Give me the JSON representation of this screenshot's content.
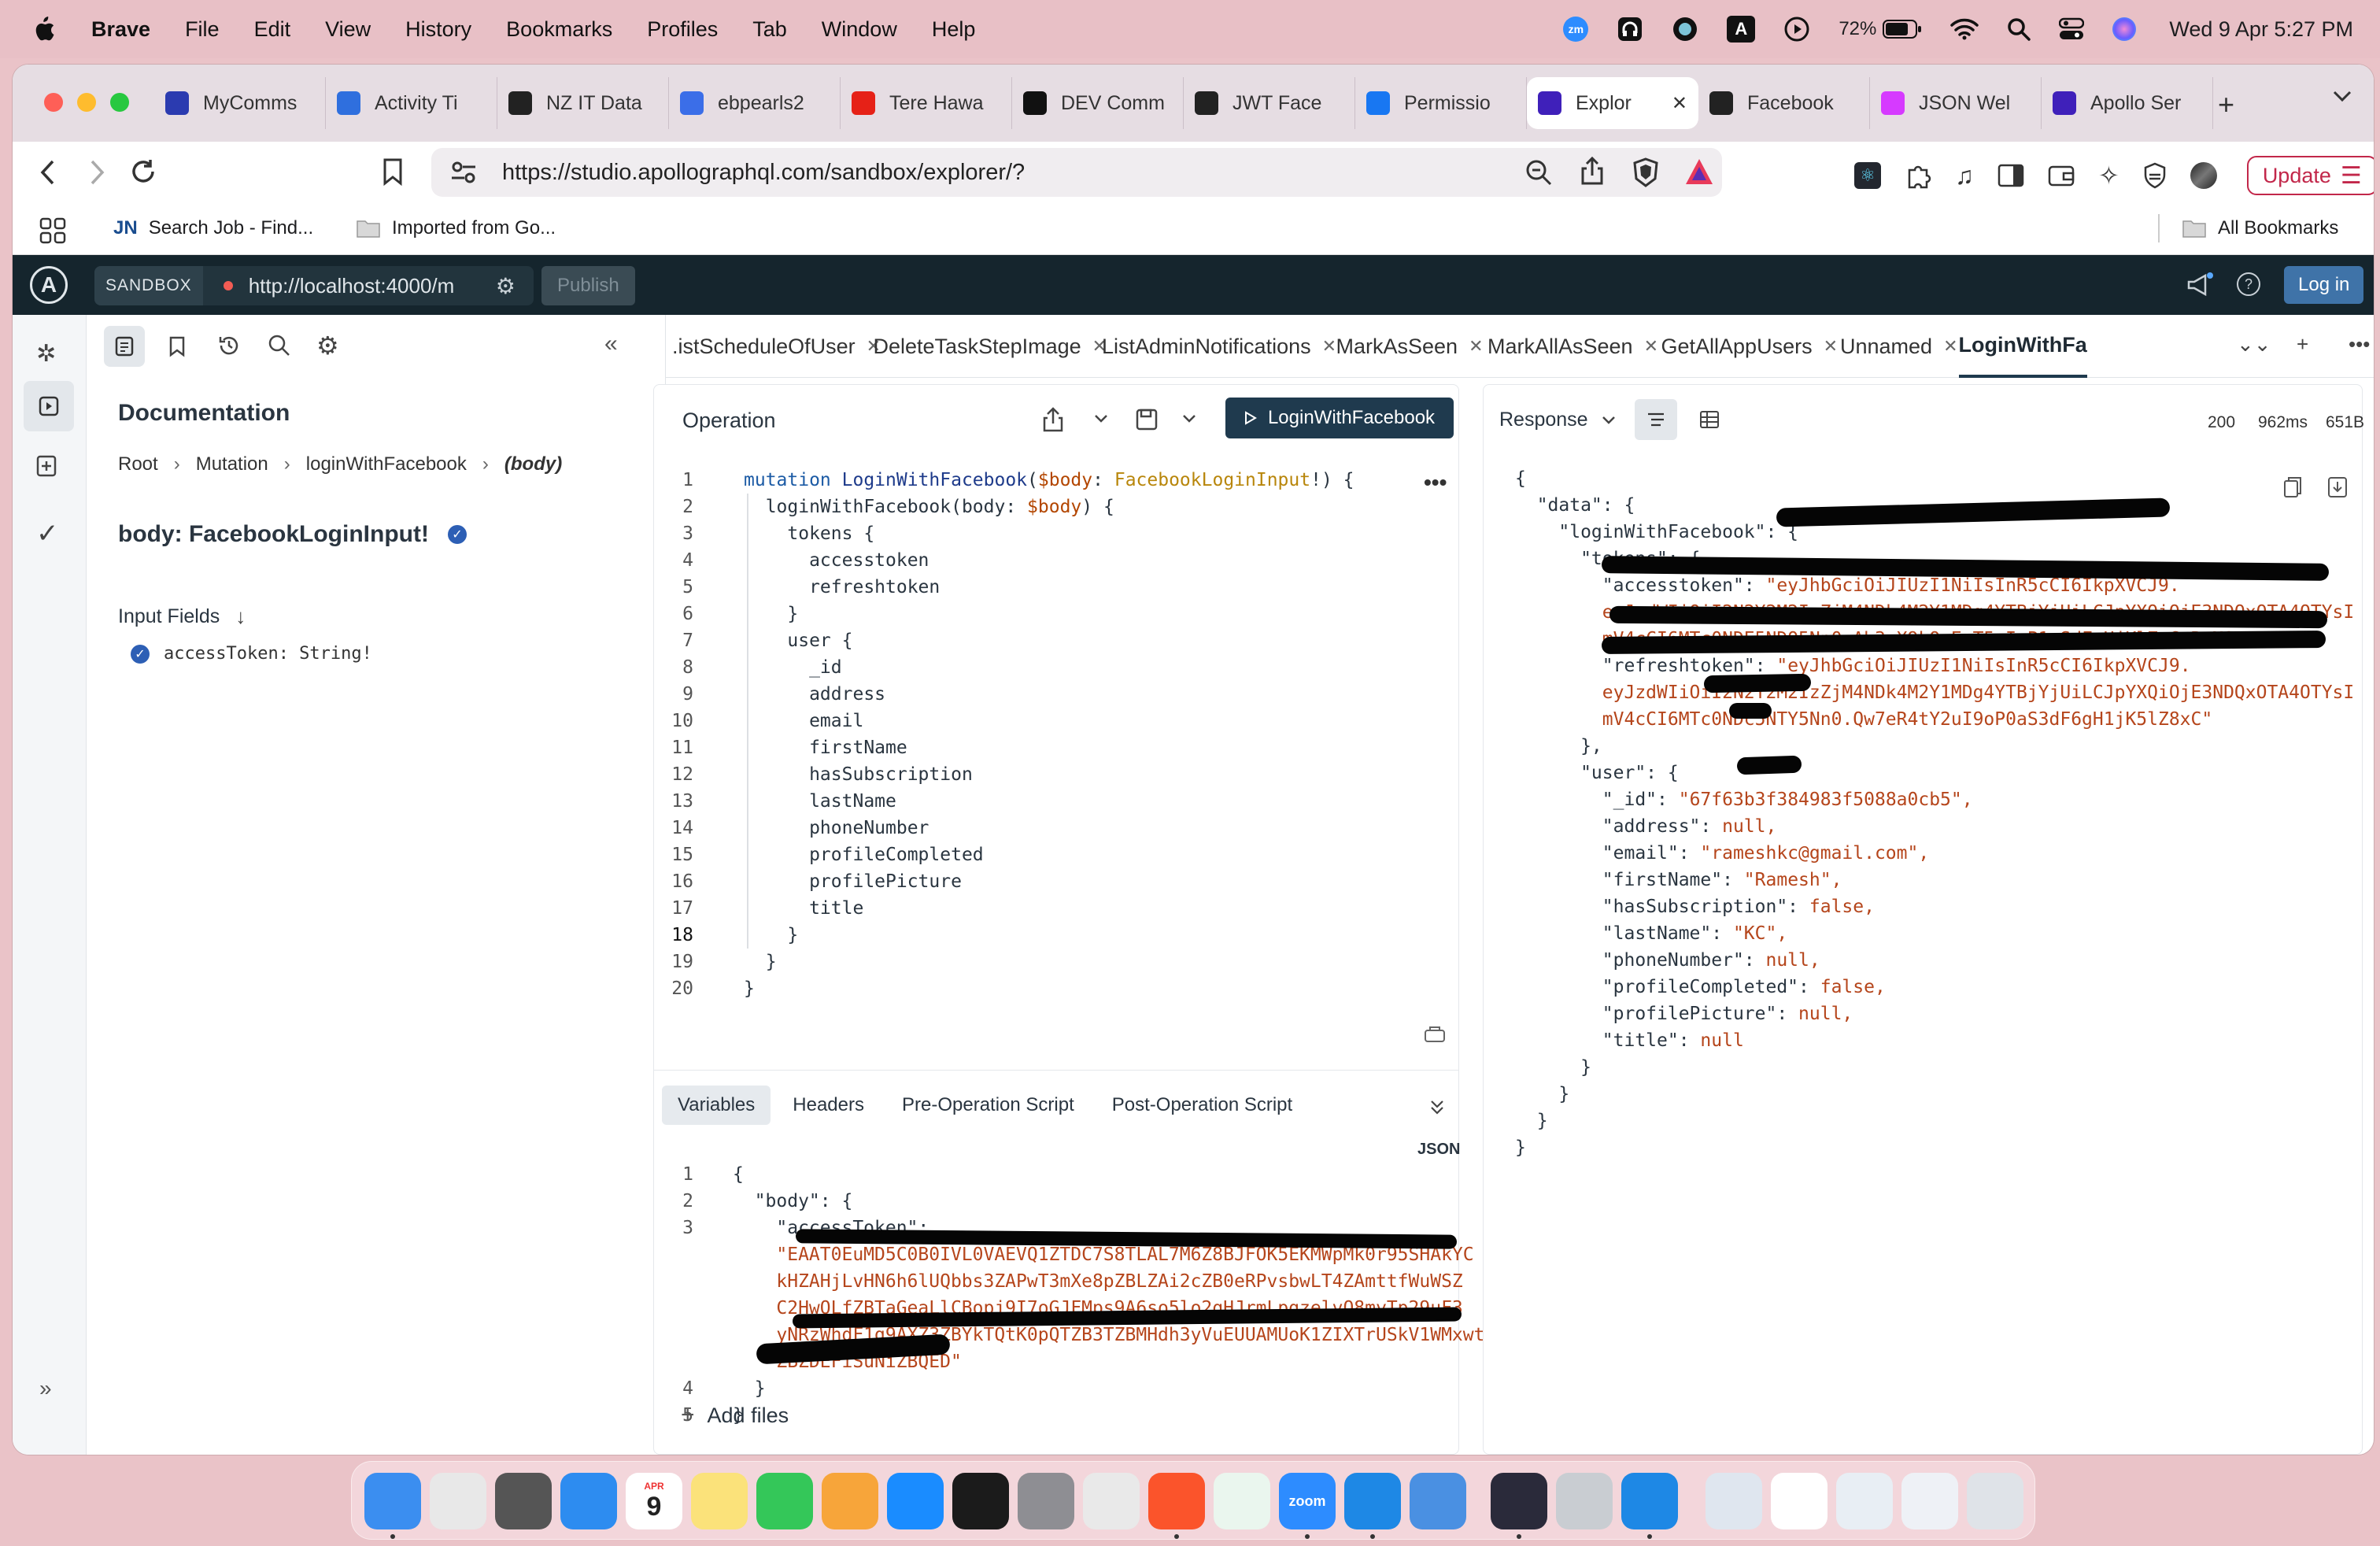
{
  "menubar": {
    "app": "Brave",
    "items": [
      "File",
      "Edit",
      "View",
      "History",
      "Bookmarks",
      "Profiles",
      "Tab",
      "Window",
      "Help"
    ],
    "battery": "72%",
    "datetime": "Wed 9 Apr  5:27 PM"
  },
  "browser": {
    "tabs": [
      {
        "label": "MyComms",
        "icon": "mycomms-icon",
        "color": "#2b3bb0"
      },
      {
        "label": "Activity Ti",
        "icon": "jira-icon",
        "color": "#2f6fde"
      },
      {
        "label": "NZ IT Data",
        "icon": "chatgpt-icon",
        "color": "#222222"
      },
      {
        "label": "ebpearls2",
        "icon": "shield-tab-icon",
        "color": "#3b6ee8"
      },
      {
        "label": "Tere Hawa",
        "icon": "youtube-icon",
        "color": "#e62117"
      },
      {
        "label": "DEV Comm",
        "icon": "dev-icon",
        "color": "#111111"
      },
      {
        "label": "JWT Face",
        "icon": "chatgpt-icon",
        "color": "#222222"
      },
      {
        "label": "Permissio",
        "icon": "facebook-icon",
        "color": "#1877f2"
      },
      {
        "label": "Explor",
        "icon": "apollo-icon",
        "color": "#3f20ba",
        "active": true
      },
      {
        "label": "Facebook",
        "icon": "chatgpt-icon",
        "color": "#222222"
      },
      {
        "label": "JSON Wel",
        "icon": "jwt-icon",
        "color": "#d63aff"
      },
      {
        "label": "Apollo Ser",
        "icon": "apollo-icon",
        "color": "#3f20ba"
      }
    ],
    "url": "https://studio.apollographql.com/sandbox/explorer/?",
    "update_label": "Update",
    "bookmarks": [
      {
        "label": "Search Job - Find...",
        "icon": "jn-icon"
      },
      {
        "label": "Imported from Go...",
        "icon": "folder-icon"
      }
    ],
    "all_bookmarks": "All Bookmarks"
  },
  "apollo": {
    "sandbox_label": "SANDBOX",
    "endpoint": "http://localhost:4000/m",
    "publish_label": "Publish",
    "login_label": "Log in"
  },
  "docs": {
    "title": "Documentation",
    "breadcrumb": [
      "Root",
      "Mutation",
      "loginWithFacebook",
      "(body)"
    ],
    "type_name": "body: FacebookLoginInput!",
    "input_fields_label": "Input Fields",
    "field": "accessToken: String!"
  },
  "op_tabs": [
    {
      "label": ".istScheduleOfUser"
    },
    {
      "label": "DeleteTaskStepImage"
    },
    {
      "label": "ListAdminNotifications"
    },
    {
      "label": "MarkAsSeen"
    },
    {
      "label": "MarkAllAsSeen"
    },
    {
      "label": "GetAllAppUsers"
    },
    {
      "label": "Unnamed"
    },
    {
      "label": "LoginWithFa",
      "active": true
    }
  ],
  "operation": {
    "title": "Operation",
    "run_label": "LoginWithFacebook",
    "code": [
      [
        [
          "kw",
          "mutation "
        ],
        [
          "fn",
          "LoginWithFacebook"
        ],
        [
          "fld",
          "("
        ],
        [
          "var",
          "$body"
        ],
        [
          "fld",
          ": "
        ],
        [
          "ty",
          "FacebookLoginInput"
        ],
        [
          "fld",
          "!) {"
        ]
      ],
      [
        [
          "fld",
          "  loginWithFacebook(body: "
        ],
        [
          "var",
          "$body"
        ],
        [
          "fld",
          ") {"
        ]
      ],
      [
        [
          "fld",
          "    tokens {"
        ]
      ],
      [
        [
          "fld",
          "      accesstoken"
        ]
      ],
      [
        [
          "fld",
          "      refreshtoken"
        ]
      ],
      [
        [
          "fld",
          "    }"
        ]
      ],
      [
        [
          "fld",
          "    user {"
        ]
      ],
      [
        [
          "fld",
          "      _id"
        ]
      ],
      [
        [
          "fld",
          "      address"
        ]
      ],
      [
        [
          "fld",
          "      email"
        ]
      ],
      [
        [
          "fld",
          "      firstName"
        ]
      ],
      [
        [
          "fld",
          "      hasSubscription"
        ]
      ],
      [
        [
          "fld",
          "      lastName"
        ]
      ],
      [
        [
          "fld",
          "      phoneNumber"
        ]
      ],
      [
        [
          "fld",
          "      profileCompleted"
        ]
      ],
      [
        [
          "fld",
          "      profilePicture"
        ]
      ],
      [
        [
          "fld",
          "      title"
        ]
      ],
      [
        [
          "fld",
          "    }"
        ]
      ],
      [
        [
          "fld",
          "  }"
        ]
      ],
      [
        [
          "fld",
          "}"
        ]
      ]
    ],
    "variables_tabs": [
      "Variables",
      "Headers",
      "Pre-Operation Script",
      "Post-Operation Script"
    ],
    "json_label": "JSON",
    "variables_code": [
      {
        "n": "1",
        "t": "{",
        "c": "fld"
      },
      {
        "n": "2",
        "t": "  \"body\": {",
        "c": "fld"
      },
      {
        "n": "3",
        "t": "    \"accessToken\":",
        "c": "fld"
      },
      {
        "n": "",
        "t": "    \"EAAT0EuMD5C0B0IVL0VAEVQ1ZTDC7S8TLAL7M6Z8BJFOK5EKMWpMk0r95SHAkYC",
        "c": "str"
      },
      {
        "n": "",
        "t": "    kHZAHjLvHN6h6lUQbbs3ZAPwT3mXe8pZBLZAi2cZB0eRPvsbwLT4ZAmttfWuWSZ",
        "c": "str"
      },
      {
        "n": "",
        "t": "    C2HwOLfZBTaGeaLlCBopj9I7oGJFMps9A6so5lo2qHJrmLpgzelvQ8myTp29uF3",
        "c": "str"
      },
      {
        "n": "",
        "t": "    yNRzWhdF1g9AXZ3ZBYkTQtK0pQTZB3TZBMHdh3yVuEUUAMUoK1ZIXTrUSkV1WMxwt",
        "c": "str"
      },
      {
        "n": "",
        "t": "    ZBZDEFiSuNiZBQED\"",
        "c": "str"
      },
      {
        "n": "4",
        "t": "  }",
        "c": "fld"
      },
      {
        "n": "5",
        "t": "}",
        "c": "fld"
      }
    ],
    "add_files_label": "Add files"
  },
  "response": {
    "title": "Response",
    "status": "200",
    "time": "962ms",
    "size": "651B",
    "lines": [
      {
        "t": "{",
        "c": "fld"
      },
      {
        "t": "  \"data\": {",
        "c": "fld"
      },
      {
        "t": "    \"loginWithFacebook\": {",
        "c": "fld"
      },
      {
        "t": "      \"tokens\": {",
        "c": "fld"
      },
      {
        "t": "        \"accesstoken\": \"eyJhbGciOiJIUzI1NiIsInR5cCI6IkpXVCJ9.",
        "c": "kv"
      },
      {
        "t": "        eyJzdWIiOiI2N2Y2M2IzZjM4NDk4M2Y1MDg4YTBjYjUiLCJpYXQiOjE3NDQxOTA4OTYsI",
        "c": "str"
      },
      {
        "t": "        mV4cCI6MTc0NDE5NDQ5Nn0.Ab3zX9kQwErT5uIoP1aSdFgHjKlZxCvBnM8\",",
        "c": "str"
      },
      {
        "t": "        \"refreshtoken\": \"eyJhbGciOiJIUzI1NiIsInR5cCI6IkpXVCJ9.",
        "c": "kv"
      },
      {
        "t": "        eyJzdWIiOiI2N2Y2M2IzZjM4NDk4M2Y1MDg4YTBjYjUiLCJpYXQiOjE3NDQxOTA4OTYsI",
        "c": "str"
      },
      {
        "t": "        mV4cCI6MTc0NDc5NTY5Nn0.Qw7eR4tY2uI9oP0aS3dF6gH1jK5lZ8xC\"",
        "c": "str"
      },
      {
        "t": "      },",
        "c": "fld"
      },
      {
        "t": "      \"user\": {",
        "c": "fld"
      },
      {
        "t": "        \"_id\": \"67f63b3f384983f5088a0cb5\",",
        "c": "kv"
      },
      {
        "t": "        \"address\": null,",
        "c": "kv"
      },
      {
        "t": "        \"email\": \"rameshkc@gmail.com\",",
        "c": "kv"
      },
      {
        "t": "        \"firstName\": \"Ramesh\",",
        "c": "kv"
      },
      {
        "t": "        \"hasSubscription\": false,",
        "c": "kv"
      },
      {
        "t": "        \"lastName\": \"KC\",",
        "c": "kv"
      },
      {
        "t": "        \"phoneNumber\": null,",
        "c": "kv"
      },
      {
        "t": "        \"profileCompleted\": false,",
        "c": "kv"
      },
      {
        "t": "        \"profilePicture\": null,",
        "c": "kv"
      },
      {
        "t": "        \"title\": null",
        "c": "kv"
      },
      {
        "t": "      }",
        "c": "fld"
      },
      {
        "t": "    }",
        "c": "fld"
      },
      {
        "t": "  }",
        "c": "fld"
      },
      {
        "t": "}",
        "c": "fld"
      }
    ]
  },
  "dock": {
    "apps": [
      {
        "name": "finder-icon",
        "color": "#3b8ef0"
      },
      {
        "name": "launchpad-icon",
        "color": "#e8e8e8"
      },
      {
        "name": "calculator-icon",
        "color": "#555555"
      },
      {
        "name": "safari-icon",
        "color": "#2d8cf0"
      },
      {
        "name": "calendar-icon",
        "color": "#ffffff",
        "text": "9",
        "sub": "APR"
      },
      {
        "name": "notes-icon",
        "color": "#fbe27a"
      },
      {
        "name": "numbers-icon",
        "color": "#34c759"
      },
      {
        "name": "pages-icon",
        "color": "#f7a53a"
      },
      {
        "name": "appstore-icon",
        "color": "#1a8cff"
      },
      {
        "name": "terminal-icon",
        "color": "#1b1b1b"
      },
      {
        "name": "system-settings-icon",
        "color": "#8e8e93"
      },
      {
        "name": "script-editor-icon",
        "color": "#e9e9e9"
      },
      {
        "name": "brave-icon",
        "color": "#fb542b"
      },
      {
        "name": "mongodb-compass-icon",
        "color": "#eaf6ee"
      },
      {
        "name": "zoom-icon",
        "color": "#2d8cff",
        "text": "zoom"
      },
      {
        "name": "vscode-icon",
        "color": "#1e88e5"
      },
      {
        "name": "cloud-icon",
        "color": "#4a90e2"
      },
      {
        "name": "cat-app-icon",
        "color": "#2a2a3a"
      },
      {
        "name": "disk-utility-icon",
        "color": "#c9cdd2"
      },
      {
        "name": "vscode-icon-2",
        "color": "#1e88e5"
      },
      {
        "name": "screenshot-thumb-1",
        "color": "#dfe6ef"
      },
      {
        "name": "screenshot-thumb-2",
        "color": "#ffffff"
      },
      {
        "name": "screenshot-thumb-3",
        "color": "#e8eef4"
      },
      {
        "name": "screenshot-thumb-4",
        "color": "#eef1f6"
      },
      {
        "name": "trash-icon",
        "color": "#dfe3e8"
      }
    ]
  }
}
